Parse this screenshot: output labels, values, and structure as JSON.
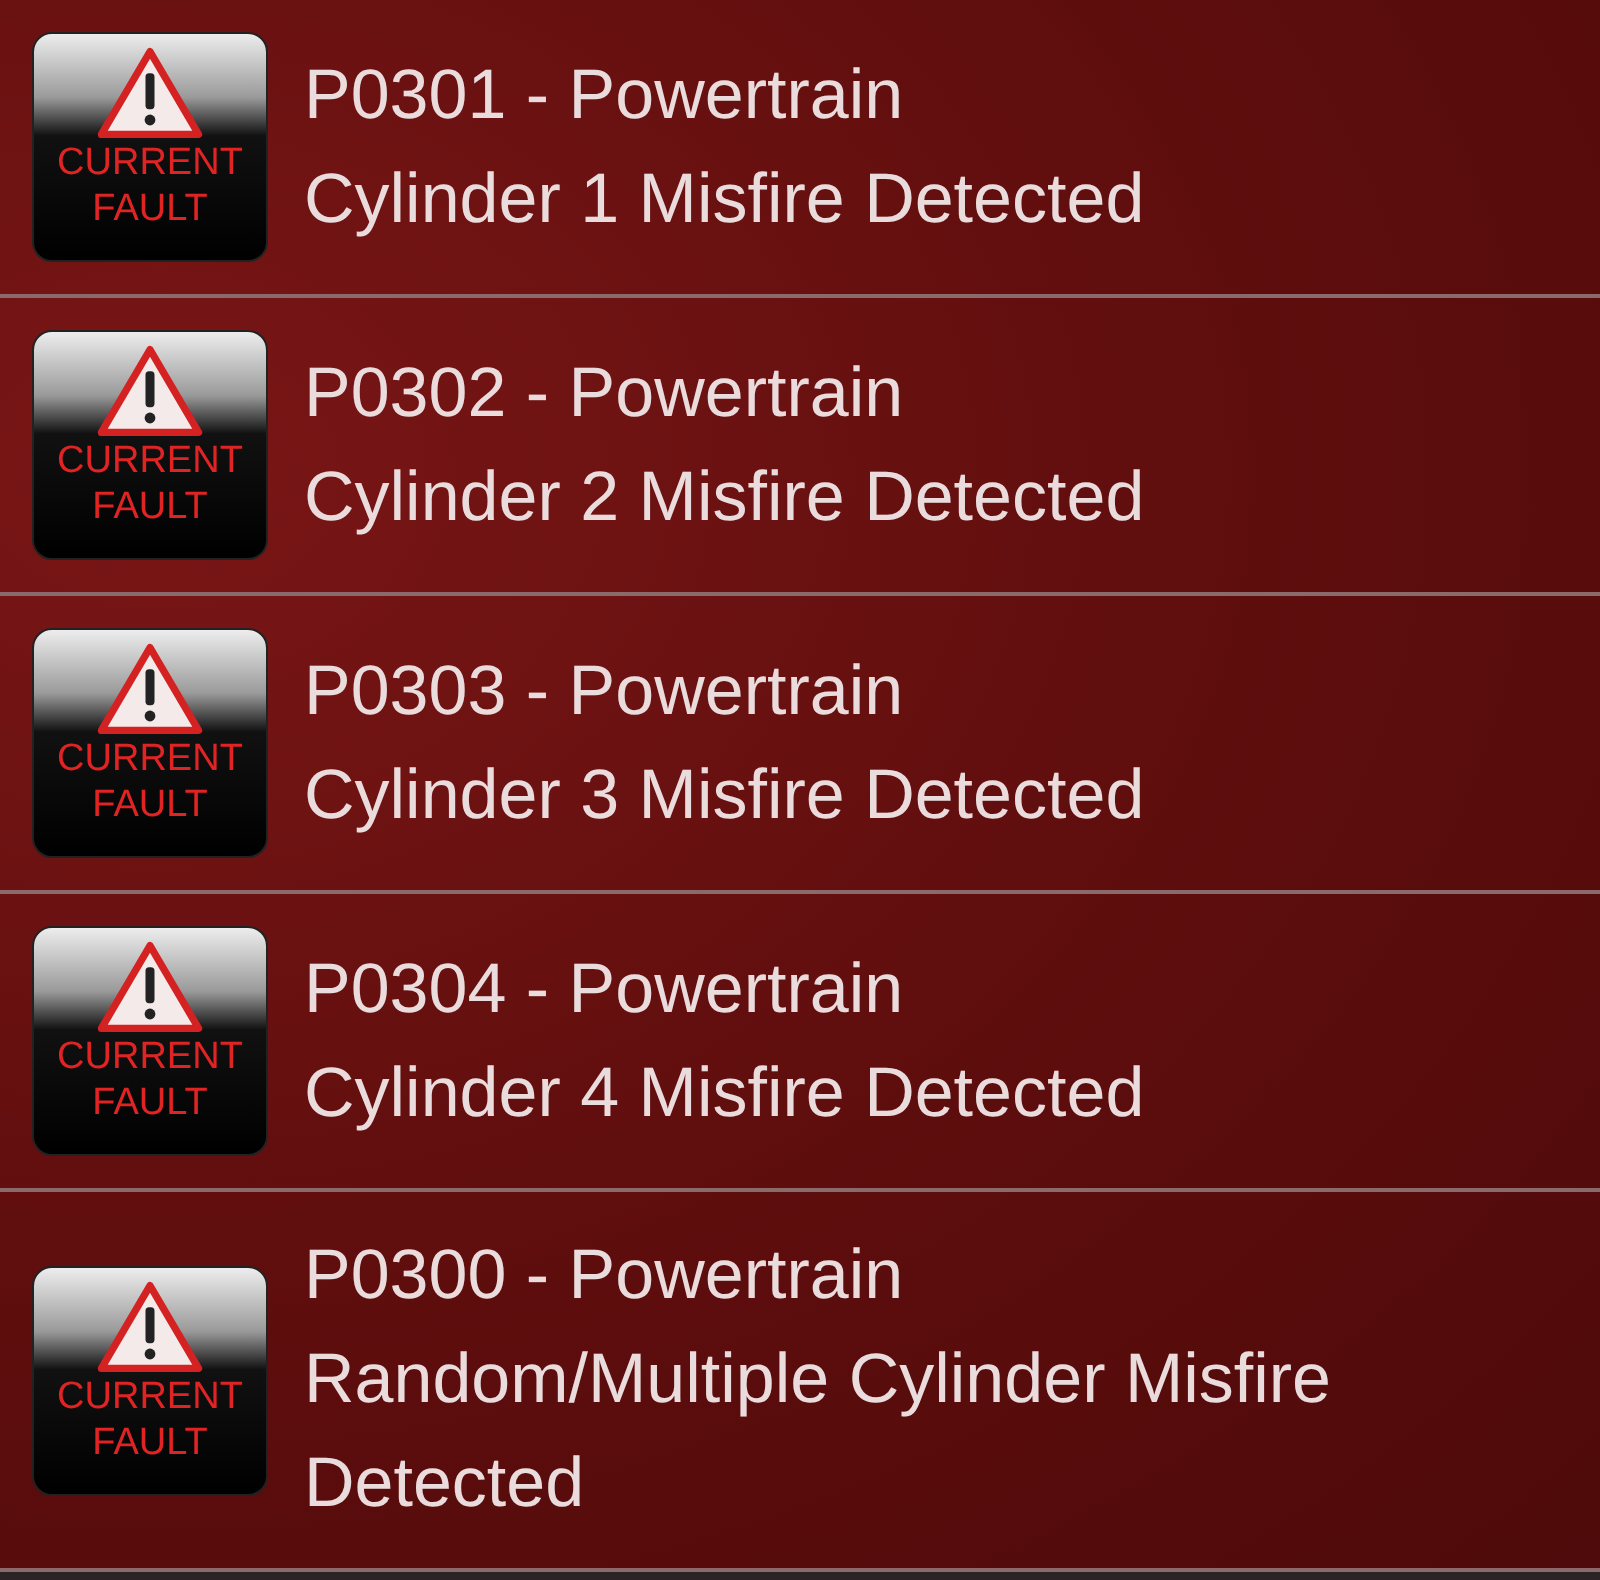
{
  "faults": [
    {
      "badge": {
        "line1": "CURRENT",
        "line2": "FAULT"
      },
      "code": "P0301 - Powertrain",
      "description": "Cylinder 1 Misfire Detected"
    },
    {
      "badge": {
        "line1": "CURRENT",
        "line2": "FAULT"
      },
      "code": "P0302 - Powertrain",
      "description": "Cylinder 2 Misfire Detected"
    },
    {
      "badge": {
        "line1": "CURRENT",
        "line2": "FAULT"
      },
      "code": "P0303 - Powertrain",
      "description": "Cylinder 3 Misfire Detected"
    },
    {
      "badge": {
        "line1": "CURRENT",
        "line2": "FAULT"
      },
      "code": "P0304 - Powertrain",
      "description": "Cylinder 4 Misfire Detected"
    },
    {
      "badge": {
        "line1": "CURRENT",
        "line2": "FAULT"
      },
      "code": "P0300 - Powertrain",
      "description": "Random/Multiple Cylinder Misfire Detected"
    }
  ]
}
